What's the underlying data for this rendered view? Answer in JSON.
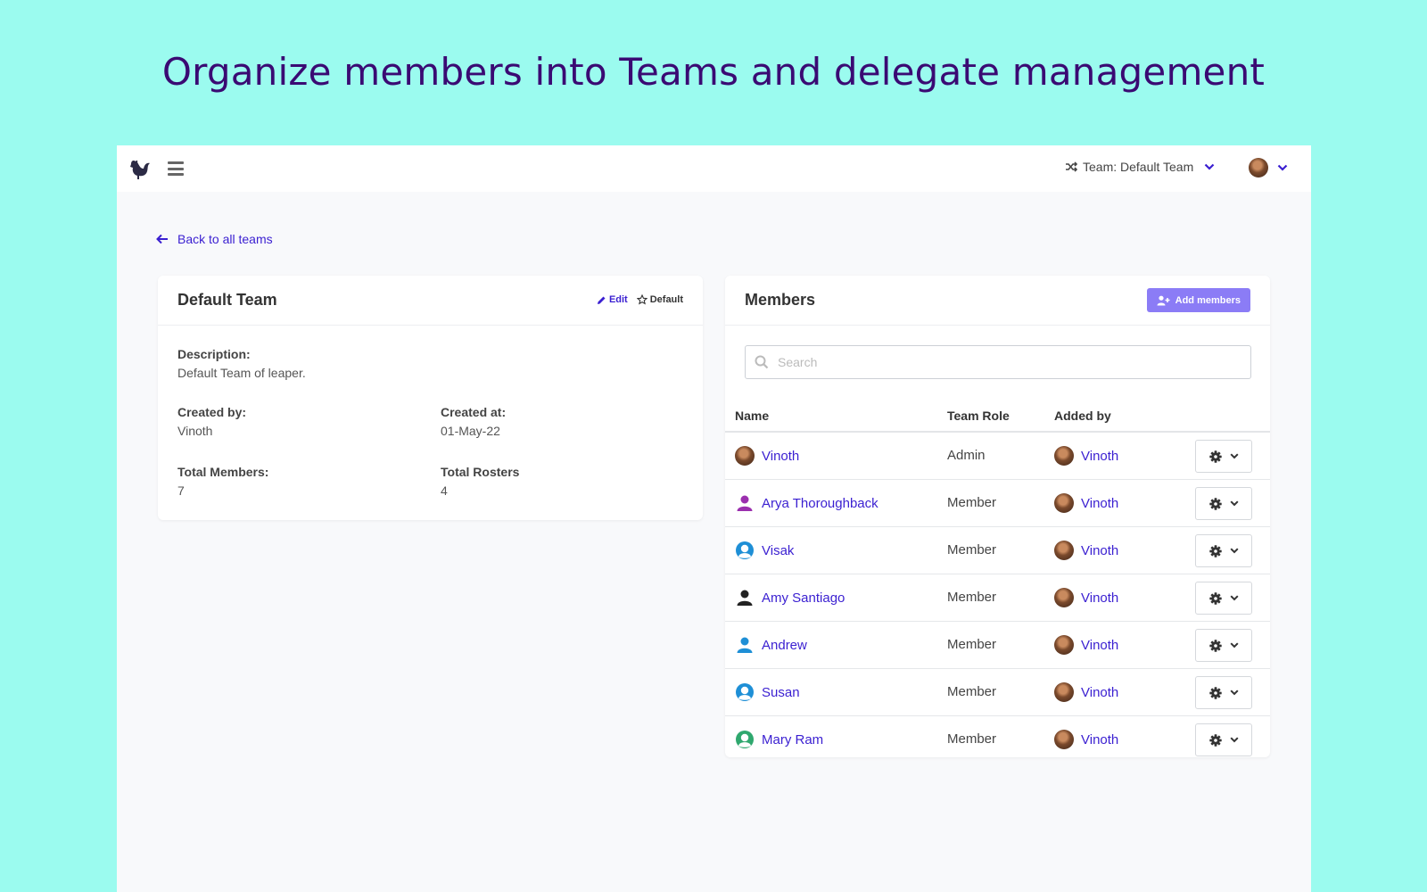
{
  "headline": "Organize members into Teams and delegate management",
  "topbar": {
    "team_switch_label": "Team: Default Team"
  },
  "back_link": "Back to all teams",
  "team": {
    "title": "Default Team",
    "edit_label": "Edit",
    "default_label": "Default",
    "description_label": "Description:",
    "description": "Default Team of leaper.",
    "created_by_label": "Created by:",
    "created_by": "Vinoth",
    "created_at_label": "Created at:",
    "created_at": "01-May-22",
    "total_members_label": "Total Members:",
    "total_members": "7",
    "total_rosters_label": "Total Rosters",
    "total_rosters": "4"
  },
  "members": {
    "title": "Members",
    "add_label": "Add members",
    "search_placeholder": "Search",
    "columns": {
      "name": "Name",
      "role": "Team Role",
      "added_by": "Added by"
    },
    "rows": [
      {
        "name": "Vinoth",
        "role": "Admin",
        "added_by": "Vinoth",
        "avatar": "photo"
      },
      {
        "name": "Arya Thoroughback",
        "role": "Member",
        "added_by": "Vinoth",
        "avatar": "user-icon-purple"
      },
      {
        "name": "Visak",
        "role": "Member",
        "added_by": "Vinoth",
        "avatar": "user-circle-icon-blue"
      },
      {
        "name": "Amy Santiago",
        "role": "Member",
        "added_by": "Vinoth",
        "avatar": "user-icon-black"
      },
      {
        "name": "Andrew",
        "role": "Member",
        "added_by": "Vinoth",
        "avatar": "user-icon-blue"
      },
      {
        "name": "Susan",
        "role": "Member",
        "added_by": "Vinoth",
        "avatar": "user-circle-icon-blue"
      },
      {
        "name": "Mary Ram",
        "role": "Member",
        "added_by": "Vinoth",
        "avatar": "user-circle-icon-green"
      }
    ]
  },
  "colors": {
    "background": "#9bfbef",
    "headline": "#3a0a73",
    "link": "#3a1fd1",
    "accent_button": "#8b7cf6"
  }
}
